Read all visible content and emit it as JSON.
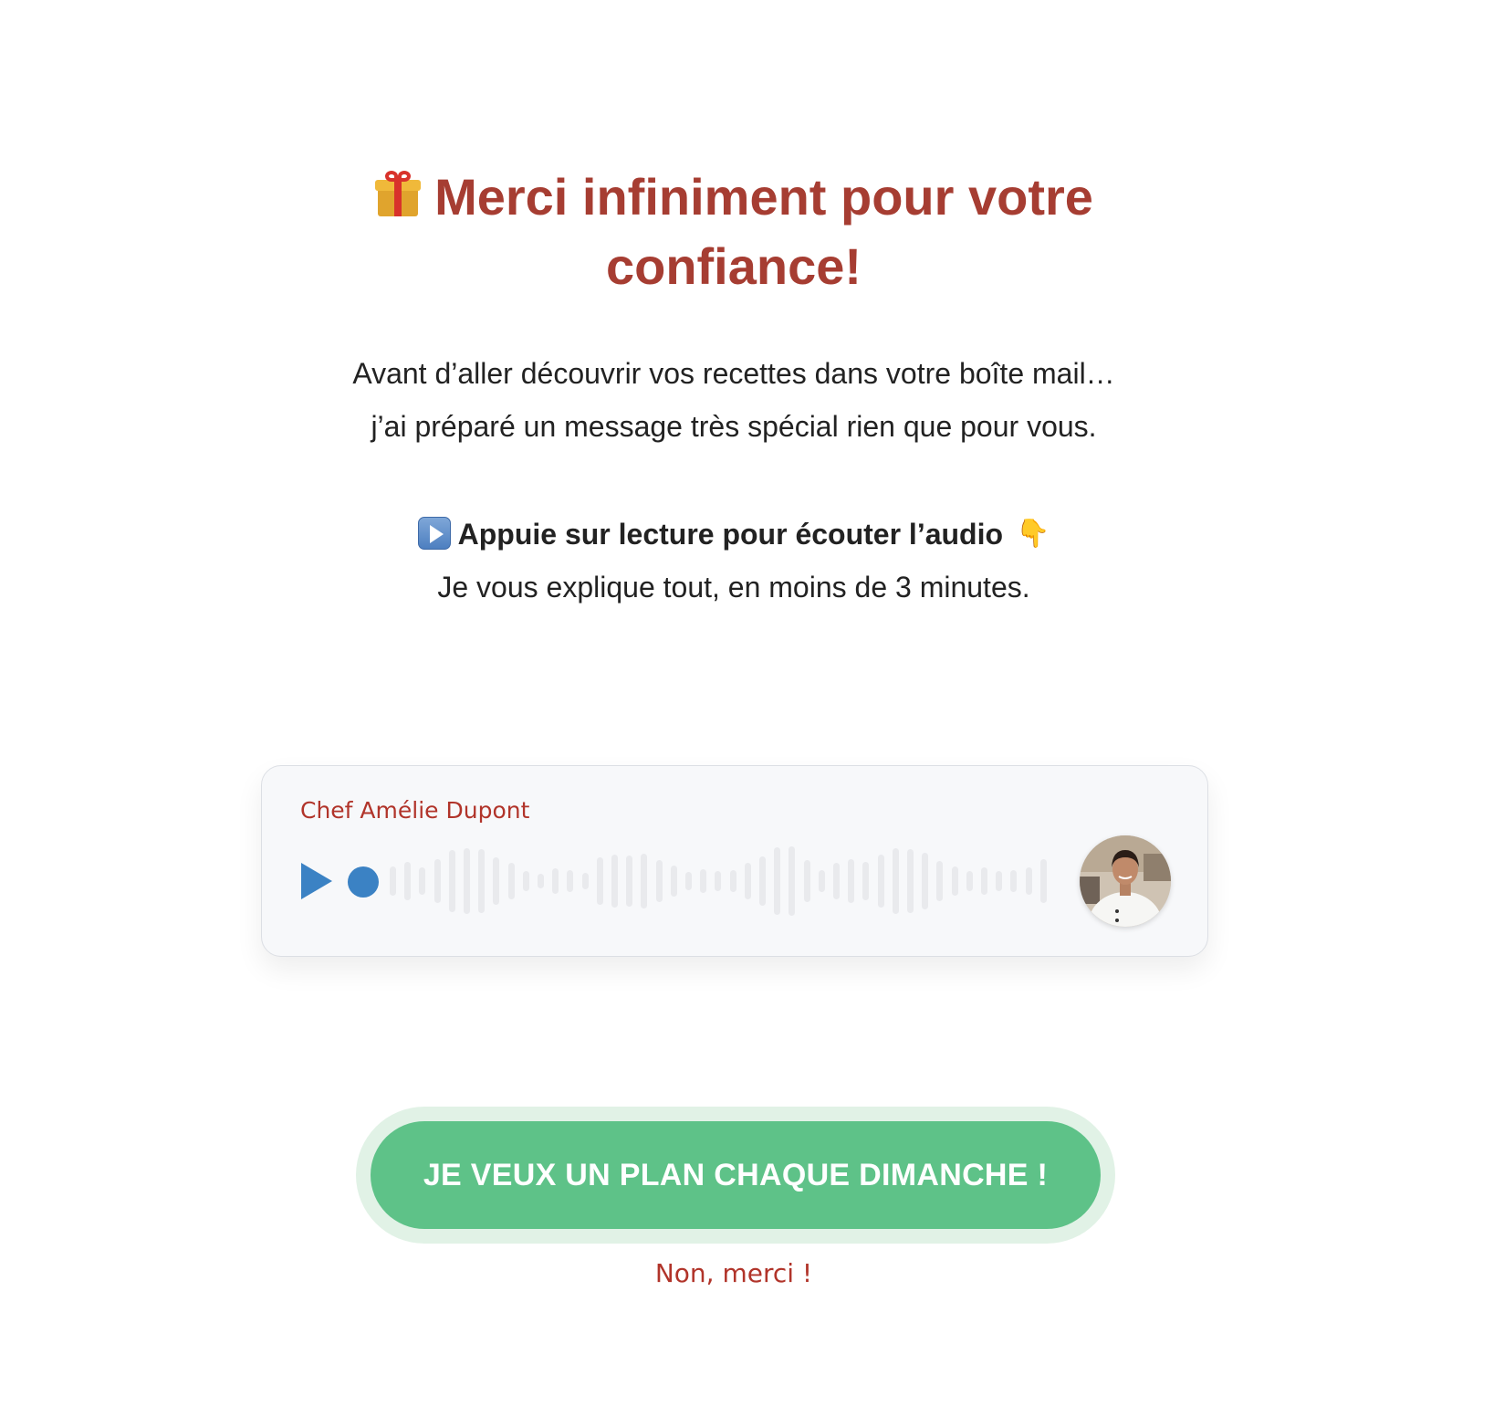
{
  "title": {
    "icon": "gift-icon",
    "line1": "Merci infiniment pour votre",
    "line2": "confiance!",
    "color": "#a63d32"
  },
  "intro": {
    "line1": "Avant d’aller découvrir vos recettes dans votre boîte mail…",
    "line2": "j’ai préparé un message très spécial rien que pour vous."
  },
  "instruction": {
    "lead_icon": "play-button-emoji-icon",
    "bold_text": "Appuie sur lecture pour écouter l’audio",
    "trail_icon": "pointing-down-hand-icon",
    "sub_text": "Je vous explique tout, en moins de 3 minutes."
  },
  "audio_player": {
    "speaker_name": "Chef Amélie Dupont",
    "play_icon": "play-icon",
    "avatar": "chef-avatar",
    "accent_color": "#3b82c4",
    "progress": 0
  },
  "cta": {
    "button_label": "JE VEUX UN PLAN CHAQUE DIMANCHE !",
    "button_color": "#5ec288",
    "decline_label": "Non, merci !"
  }
}
